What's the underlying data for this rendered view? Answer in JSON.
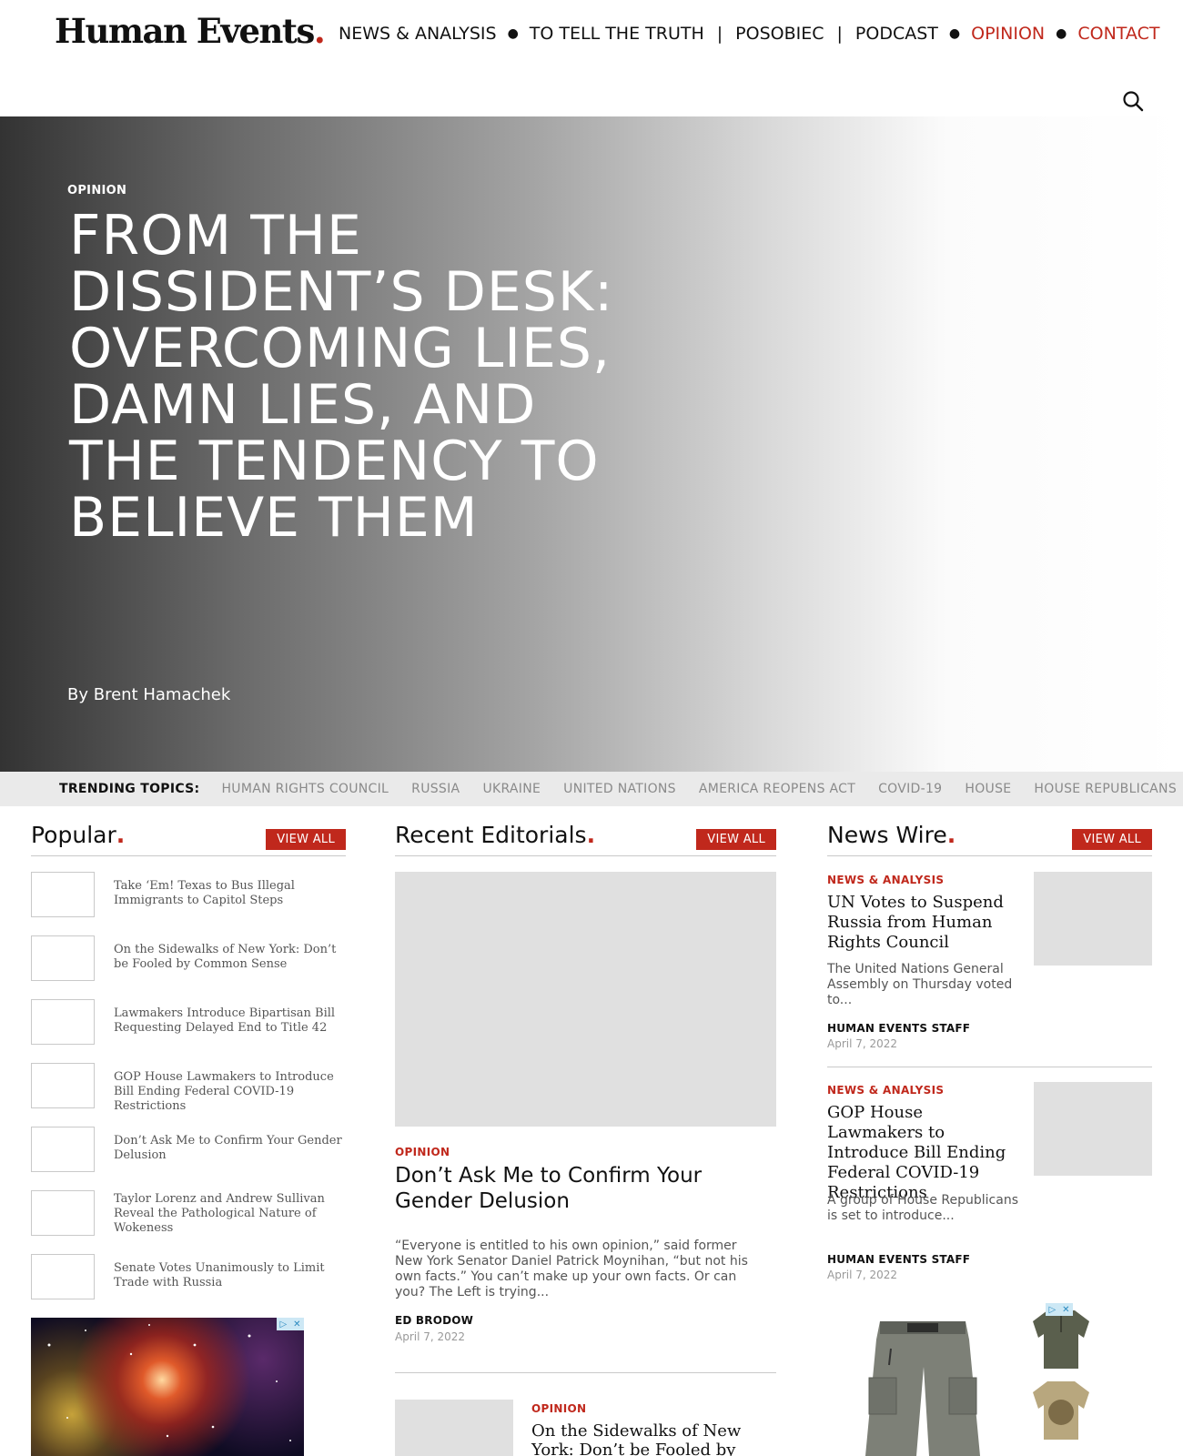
{
  "site": {
    "logo_text": "Human Events",
    "logo_dot": "."
  },
  "nav": {
    "news": "NEWS & ANALYSIS",
    "truth": "TO TELL THE TRUTH",
    "posobiec": "POSOBIEC",
    "podcast": "PODCAST",
    "opinion": "OPINION",
    "contact": "CONTACT"
  },
  "hero": {
    "category": "OPINION",
    "title": "FROM THE DISSIDENT’S DESK: OVERCOMING LIES, DAMN LIES, AND THE TENDENCY TO BELIEVE THEM",
    "author": "By Brent Hamachek"
  },
  "trending": {
    "label": "TRENDING TOPICS:",
    "topics": [
      "HUMAN RIGHTS COUNCIL",
      "RUSSIA",
      "UKRAINE",
      "UNITED NATIONS",
      "AMERICA REOPENS ACT",
      "COVID-19",
      "HOUSE",
      "HOUSE REPUBLICANS"
    ]
  },
  "popular": {
    "title": "Popular",
    "dot": ".",
    "view_all": "VIEW ALL",
    "items": [
      "Take ‘Em! Texas to Bus Illegal Immigrants to Capitol Steps",
      "On the Sidewalks of New York: Don’t be Fooled by Common Sense",
      "Lawmakers Introduce Bipartisan Bill Requesting Delayed End to Title 42",
      "GOP House Lawmakers to Introduce Bill Ending Federal COVID-19 Restrictions",
      "Don’t Ask Me to Confirm Your Gender Delusion",
      "Taylor Lorenz and Andrew Sullivan Reveal the Pathological Nature of Wokeness",
      "Senate Votes Unanimously to Limit Trade with Russia"
    ]
  },
  "editorials": {
    "title": "Recent Editorials",
    "dot": ".",
    "view_all": "VIEW ALL",
    "lead": {
      "category": "OPINION",
      "headline": "Don’t Ask Me to Confirm Your Gender Delusion",
      "excerpt": "“Everyone is entitled to his own opinion,” said former New York Senator Daniel Patrick Moynihan, “but not his own facts.” You can’t make up your own facts. Or can you? The Left is trying...",
      "author": "ED BRODOW",
      "date": "April 7, 2022"
    },
    "second": {
      "category": "OPINION",
      "headline": "On the Sidewalks of New York: Don’t be Fooled by Common"
    }
  },
  "newswire": {
    "title": "News Wire",
    "dot": ".",
    "view_all": "VIEW ALL",
    "items": [
      {
        "category": "NEWS & ANALYSIS",
        "headline": "UN Votes to Suspend Russia from Human Rights Council",
        "excerpt": "The United Nations General Assembly on Thursday voted to...",
        "author": "HUMAN EVENTS STAFF",
        "date": "April 7, 2022"
      },
      {
        "category": "NEWS & ANALYSIS",
        "headline": "GOP House Lawmakers to Introduce Bill Ending Federal COVID-19 Restrictions",
        "excerpt": "A group of House Republicans is set to introduce...",
        "author": "HUMAN EVENTS STAFF",
        "date": "April 7, 2022"
      }
    ]
  },
  "ads": {
    "badge_info": "▷",
    "badge_close": "✕"
  },
  "colors": {
    "accent": "#c0281c",
    "placeholder": "#e0e0e0",
    "trending_bg": "#eaeaea"
  }
}
